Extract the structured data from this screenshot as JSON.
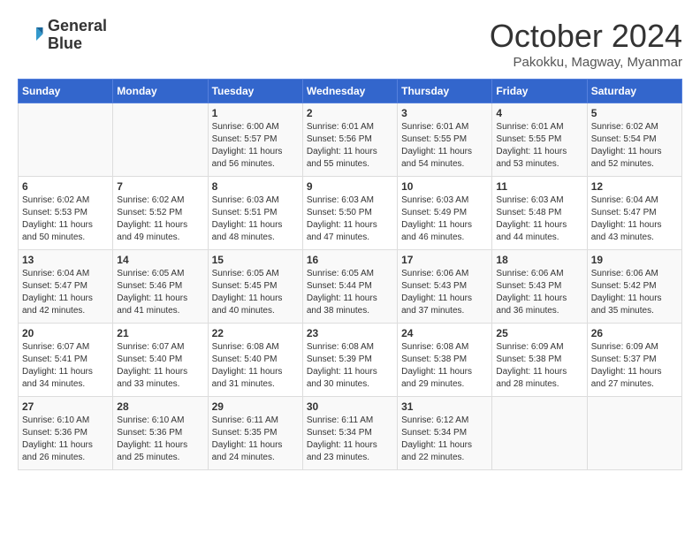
{
  "logo": {
    "line1": "General",
    "line2": "Blue"
  },
  "title": "October 2024",
  "subtitle": "Pakokku, Magway, Myanmar",
  "weekdays": [
    "Sunday",
    "Monday",
    "Tuesday",
    "Wednesday",
    "Thursday",
    "Friday",
    "Saturday"
  ],
  "weeks": [
    [
      {
        "day": "",
        "info": ""
      },
      {
        "day": "",
        "info": ""
      },
      {
        "day": "1",
        "info": "Sunrise: 6:00 AM\nSunset: 5:57 PM\nDaylight: 11 hours\nand 56 minutes."
      },
      {
        "day": "2",
        "info": "Sunrise: 6:01 AM\nSunset: 5:56 PM\nDaylight: 11 hours\nand 55 minutes."
      },
      {
        "day": "3",
        "info": "Sunrise: 6:01 AM\nSunset: 5:55 PM\nDaylight: 11 hours\nand 54 minutes."
      },
      {
        "day": "4",
        "info": "Sunrise: 6:01 AM\nSunset: 5:55 PM\nDaylight: 11 hours\nand 53 minutes."
      },
      {
        "day": "5",
        "info": "Sunrise: 6:02 AM\nSunset: 5:54 PM\nDaylight: 11 hours\nand 52 minutes."
      }
    ],
    [
      {
        "day": "6",
        "info": "Sunrise: 6:02 AM\nSunset: 5:53 PM\nDaylight: 11 hours\nand 50 minutes."
      },
      {
        "day": "7",
        "info": "Sunrise: 6:02 AM\nSunset: 5:52 PM\nDaylight: 11 hours\nand 49 minutes."
      },
      {
        "day": "8",
        "info": "Sunrise: 6:03 AM\nSunset: 5:51 PM\nDaylight: 11 hours\nand 48 minutes."
      },
      {
        "day": "9",
        "info": "Sunrise: 6:03 AM\nSunset: 5:50 PM\nDaylight: 11 hours\nand 47 minutes."
      },
      {
        "day": "10",
        "info": "Sunrise: 6:03 AM\nSunset: 5:49 PM\nDaylight: 11 hours\nand 46 minutes."
      },
      {
        "day": "11",
        "info": "Sunrise: 6:03 AM\nSunset: 5:48 PM\nDaylight: 11 hours\nand 44 minutes."
      },
      {
        "day": "12",
        "info": "Sunrise: 6:04 AM\nSunset: 5:47 PM\nDaylight: 11 hours\nand 43 minutes."
      }
    ],
    [
      {
        "day": "13",
        "info": "Sunrise: 6:04 AM\nSunset: 5:47 PM\nDaylight: 11 hours\nand 42 minutes."
      },
      {
        "day": "14",
        "info": "Sunrise: 6:05 AM\nSunset: 5:46 PM\nDaylight: 11 hours\nand 41 minutes."
      },
      {
        "day": "15",
        "info": "Sunrise: 6:05 AM\nSunset: 5:45 PM\nDaylight: 11 hours\nand 40 minutes."
      },
      {
        "day": "16",
        "info": "Sunrise: 6:05 AM\nSunset: 5:44 PM\nDaylight: 11 hours\nand 38 minutes."
      },
      {
        "day": "17",
        "info": "Sunrise: 6:06 AM\nSunset: 5:43 PM\nDaylight: 11 hours\nand 37 minutes."
      },
      {
        "day": "18",
        "info": "Sunrise: 6:06 AM\nSunset: 5:43 PM\nDaylight: 11 hours\nand 36 minutes."
      },
      {
        "day": "19",
        "info": "Sunrise: 6:06 AM\nSunset: 5:42 PM\nDaylight: 11 hours\nand 35 minutes."
      }
    ],
    [
      {
        "day": "20",
        "info": "Sunrise: 6:07 AM\nSunset: 5:41 PM\nDaylight: 11 hours\nand 34 minutes."
      },
      {
        "day": "21",
        "info": "Sunrise: 6:07 AM\nSunset: 5:40 PM\nDaylight: 11 hours\nand 33 minutes."
      },
      {
        "day": "22",
        "info": "Sunrise: 6:08 AM\nSunset: 5:40 PM\nDaylight: 11 hours\nand 31 minutes."
      },
      {
        "day": "23",
        "info": "Sunrise: 6:08 AM\nSunset: 5:39 PM\nDaylight: 11 hours\nand 30 minutes."
      },
      {
        "day": "24",
        "info": "Sunrise: 6:08 AM\nSunset: 5:38 PM\nDaylight: 11 hours\nand 29 minutes."
      },
      {
        "day": "25",
        "info": "Sunrise: 6:09 AM\nSunset: 5:38 PM\nDaylight: 11 hours\nand 28 minutes."
      },
      {
        "day": "26",
        "info": "Sunrise: 6:09 AM\nSunset: 5:37 PM\nDaylight: 11 hours\nand 27 minutes."
      }
    ],
    [
      {
        "day": "27",
        "info": "Sunrise: 6:10 AM\nSunset: 5:36 PM\nDaylight: 11 hours\nand 26 minutes."
      },
      {
        "day": "28",
        "info": "Sunrise: 6:10 AM\nSunset: 5:36 PM\nDaylight: 11 hours\nand 25 minutes."
      },
      {
        "day": "29",
        "info": "Sunrise: 6:11 AM\nSunset: 5:35 PM\nDaylight: 11 hours\nand 24 minutes."
      },
      {
        "day": "30",
        "info": "Sunrise: 6:11 AM\nSunset: 5:34 PM\nDaylight: 11 hours\nand 23 minutes."
      },
      {
        "day": "31",
        "info": "Sunrise: 6:12 AM\nSunset: 5:34 PM\nDaylight: 11 hours\nand 22 minutes."
      },
      {
        "day": "",
        "info": ""
      },
      {
        "day": "",
        "info": ""
      }
    ]
  ]
}
